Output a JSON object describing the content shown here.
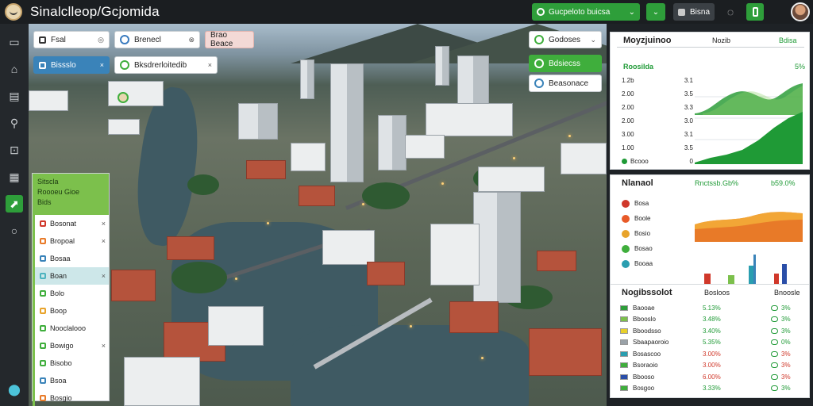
{
  "app": {
    "title": "Sinalclleop/Gcjomida"
  },
  "topbar": {
    "select_label": "Gucpeloto buicsa",
    "button_label": "Bisna"
  },
  "sidebar_icons": [
    "folder-icon",
    "home-icon",
    "document-icon",
    "pin-icon",
    "briefcase-icon",
    "calendar-icon",
    "chart-icon",
    "search-icon"
  ],
  "map_controls": {
    "chip1": "Fsal",
    "chip2": "Brenecl",
    "chip3": "Brao Beace",
    "chip4": "Bissslo",
    "chip5": "Bksdrerloitedib",
    "chip6": "Godoses",
    "chip7": "Bdsiecss",
    "chip8": "Beasonace"
  },
  "layers_panel": {
    "head": [
      "Sitscla",
      "Roooeu Gioe",
      "Bids"
    ],
    "rows": [
      {
        "label": "Bosonat",
        "x": "×",
        "color": "#d0382a"
      },
      {
        "label": "Bropoal",
        "x": "×",
        "color": "#e87a28"
      },
      {
        "label": "Bosaa",
        "x": "",
        "color": "#3a83b9"
      },
      {
        "label": "Boan",
        "x": "×",
        "color": "#4cb3bf",
        "highlight": true
      },
      {
        "label": "Bolo",
        "x": "",
        "color": "#3fae3c"
      },
      {
        "label": "Boop",
        "x": "",
        "color": "#e8a32a"
      },
      {
        "label": "Nooclalooo",
        "x": "",
        "color": "#3fae3c"
      },
      {
        "label": "Bowigo",
        "x": "×",
        "color": "#3fae3c"
      },
      {
        "label": "Bisobo",
        "x": "",
        "color": "#3fae3c"
      },
      {
        "label": "Bsoa",
        "x": "",
        "color": "#3a83b9"
      },
      {
        "label": "Bosgio",
        "x": "",
        "color": "#e87a28"
      }
    ]
  },
  "card1": {
    "title": "Moyzjuinoo",
    "right1": "Nozib",
    "right2": "Bdisa",
    "subtitle": "Roosilda",
    "subtitle_right": "5%",
    "rows": [
      {
        "label": "1.2b",
        "value": "3.1"
      },
      {
        "label": "2.00",
        "value": "3.5"
      },
      {
        "label": "2.00",
        "value": "3.3"
      },
      {
        "label": "2.00",
        "value": "3.0"
      },
      {
        "label": "3.00",
        "value": "3.1"
      },
      {
        "label": "1.00",
        "value": "3.5"
      },
      {
        "label": "Bcooo",
        "value": "0"
      }
    ]
  },
  "card2": {
    "title": "Nlanaol",
    "center": "Rnctssb.Gb%",
    "right": "b59.0%",
    "items": [
      "Bosa",
      "Boole",
      "Bosio",
      "Bosao",
      "Booaa"
    ]
  },
  "card3": {
    "title": "Nogibssolot",
    "col1": "Bosloos",
    "col2": "Bnoosle",
    "rows": [
      {
        "label": "Baooae",
        "v1": "5.13%",
        "v2": "3%",
        "c1": "g"
      },
      {
        "label": "Bbooslo",
        "v1": "3.48%",
        "v2": "3%",
        "c1": "g"
      },
      {
        "label": "Bboodsso",
        "v1": "3.40%",
        "v2": "3%",
        "c1": "g"
      },
      {
        "label": "Sbaapaoroio",
        "v1": "5.35%",
        "v2": "0%",
        "c1": "g"
      },
      {
        "label": "Bosascoo",
        "v1": "3.00%",
        "v2": "3%",
        "c1": "r"
      },
      {
        "label": "Bsoraoio",
        "v1": "3.00%",
        "v2": "3%",
        "c1": "r"
      },
      {
        "label": "Bbooso",
        "v1": "6.00%",
        "v2": "3%",
        "c1": "r"
      },
      {
        "label": "Bosgoo",
        "v1": "3.33%",
        "v2": "3%",
        "c1": "g"
      }
    ]
  },
  "colors": {
    "accent": "#2e9e3a",
    "chart_green": "#1f9a36",
    "chart_orange": "#e87a28",
    "chart_red": "#d0382a"
  }
}
